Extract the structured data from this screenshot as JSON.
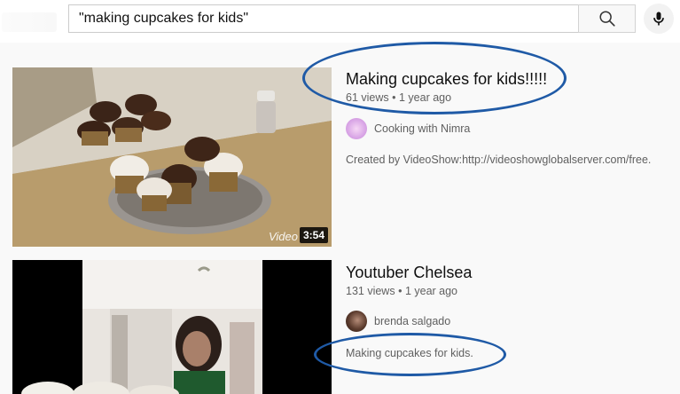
{
  "search": {
    "query": "\"making cupcakes for kids\""
  },
  "icons": {
    "search": "search-icon",
    "mic": "mic-icon"
  },
  "results": [
    {
      "title": "Making cupcakes for kids!!!!!",
      "views": "61 views",
      "age": "1 year ago",
      "channel": "Cooking with Nimra",
      "description": "Created by VideoShow:http://videoshowglobalserver.com/free.",
      "duration": "3:54",
      "watermark": "Video"
    },
    {
      "title": "Youtuber Chelsea",
      "views": "131 views",
      "age": "1 year ago",
      "channel": "brenda salgado",
      "description": "Making cupcakes for kids."
    }
  ],
  "annotation_color": "#1f5aa6"
}
